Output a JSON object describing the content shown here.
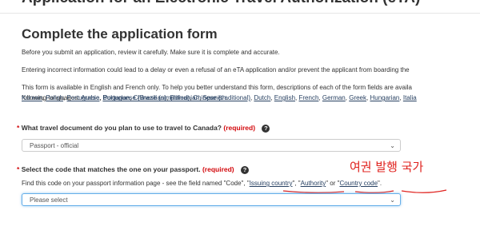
{
  "header": {
    "title": "Application for an Electronic Travel Authorization (eTA)"
  },
  "form": {
    "title": "Complete the application form",
    "intro_review": "Before you submit an application, review it carefully. Make sure it is complete and accurate.",
    "intro_warning": "Entering incorrect information could lead to a delay or even a refusal of an eTA application and/or prevent the applicant from boarding the",
    "intro_languages": "This form is available in English and French only. To help you better understand this form, descriptions of each of the form fields are availa",
    "languages_lead": "following languages:",
    "languages_line1": [
      "Arabic",
      "Bulgarian",
      "Chinese (simplified)",
      "Chinese (traditional)",
      "Dutch",
      "English",
      "French",
      "German",
      "Greek",
      "Hungarian",
      "Italia"
    ],
    "languages_line2": [
      "Korean",
      "Polish",
      "Portuguese",
      "Portuguese (Brazilian)",
      "Romanian",
      "Spanish"
    ]
  },
  "question_travel_doc": {
    "star": "*",
    "label": "What travel document do you plan to use to travel to Canada?",
    "required": "(required)",
    "help_icon": "?",
    "selected_value": "Passport - official"
  },
  "question_code": {
    "star": "*",
    "label": "Select the code that matches the one on your passport.",
    "required": "(required)",
    "help_icon": "?",
    "hint_prefix": "Find this code on your passport information page - see the field named \"Code\", \"",
    "term_issuing": "Issuing country",
    "hint_mid1": "\", \"",
    "term_authority": "Authority",
    "hint_mid2": "\" or \"",
    "term_country_code": "Country code",
    "hint_suffix": "\".",
    "placeholder": "Please select"
  },
  "annotation": {
    "text": "여권 발행 국가",
    "color": "#e0231f"
  },
  "colors": {
    "required_red": "#d3080c",
    "link": "#284162",
    "focus_border": "#66afe9"
  },
  "icons": {
    "select_chevron": "chevron-down-icon",
    "help": "question-circle-icon"
  }
}
